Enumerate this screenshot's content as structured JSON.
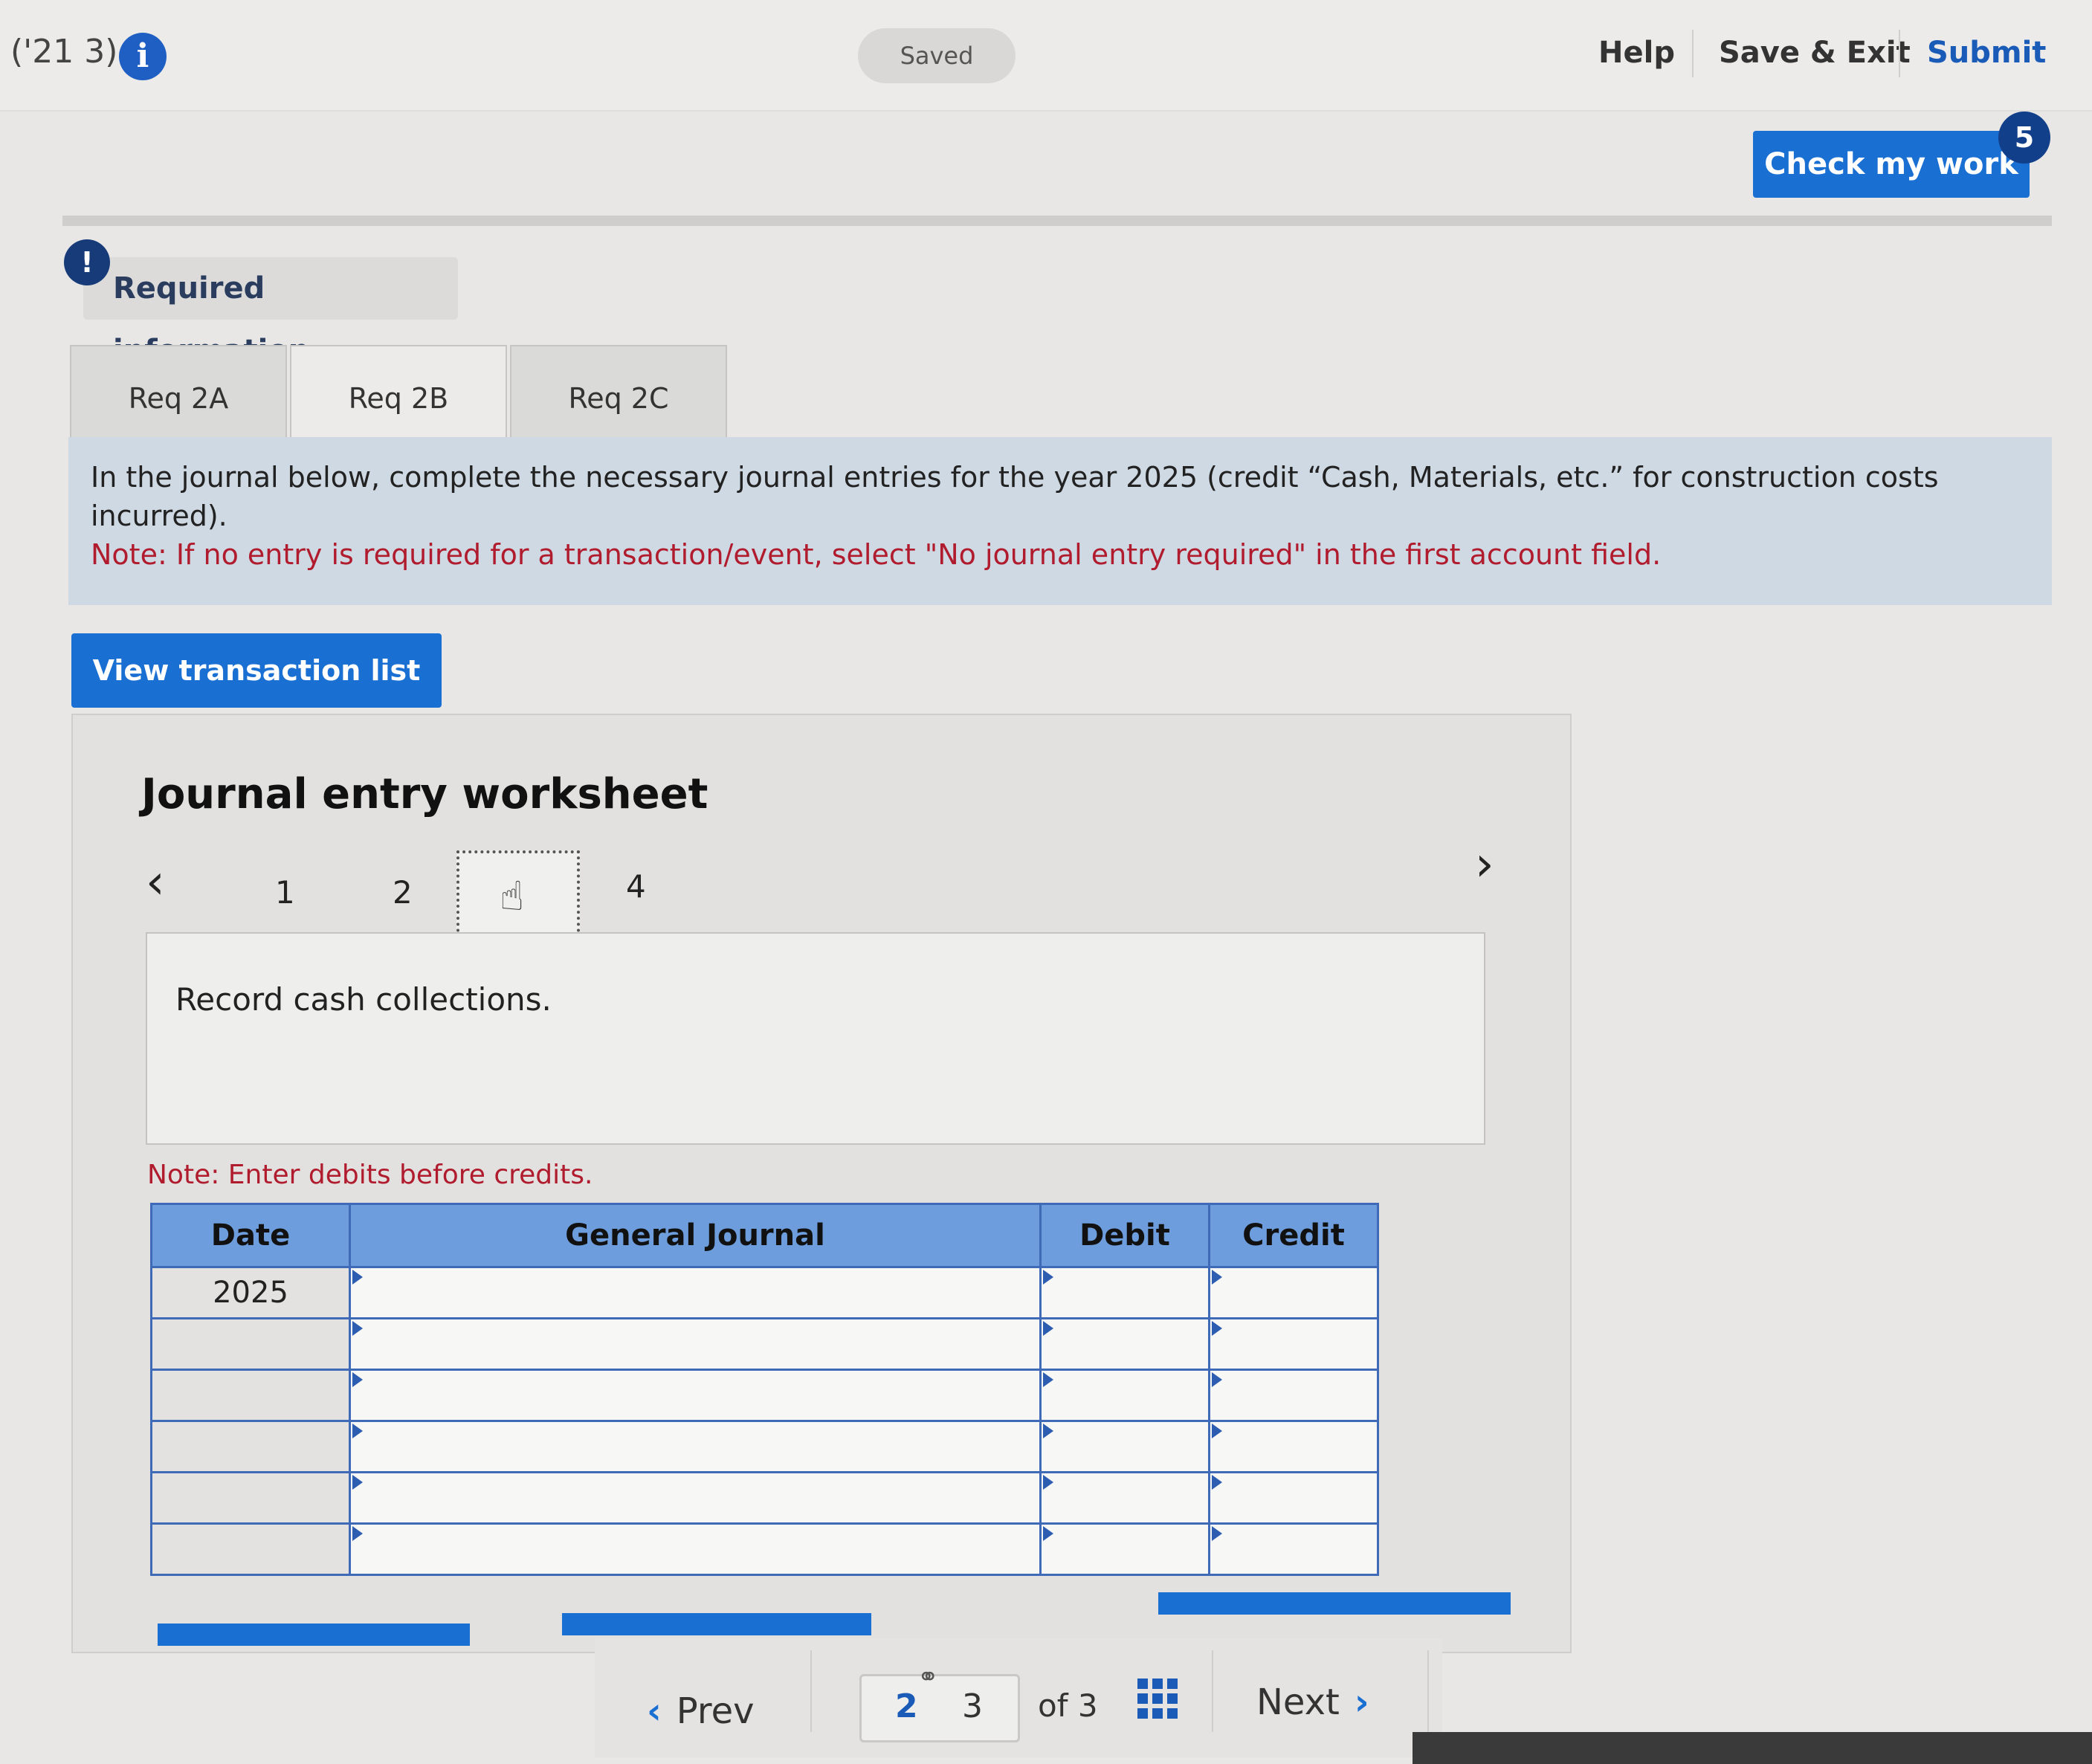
{
  "header": {
    "question_ref": "('21 3)",
    "status": "Saved",
    "links": [
      "Help",
      "Save & Exit",
      "Submit"
    ],
    "check_button": "Check my work",
    "check_badge": "5"
  },
  "required_info": {
    "icon": "!",
    "label": "Required information"
  },
  "tabs": [
    "Req 2A",
    "Req 2B",
    "Req 2C"
  ],
  "instruction": {
    "text": "In the journal below, complete the necessary journal entries for the year 2025 (credit “Cash, Materials, etc.” for construction costs incurred).",
    "note": "Note: If no entry is required for a transaction/event, select \"No journal entry required\" in the first account field."
  },
  "view_button": "View transaction list",
  "worksheet": {
    "title": "Journal entry worksheet",
    "pages": [
      "1",
      "2",
      "3",
      "4"
    ],
    "active_page": "3",
    "description": "Record cash collections.",
    "note": "Note: Enter debits before credits.",
    "columns": [
      "Date",
      "General Journal",
      "Debit",
      "Credit"
    ],
    "rows": [
      {
        "date": "2025",
        "account": "",
        "debit": "",
        "credit": ""
      },
      {
        "date": "",
        "account": "",
        "debit": "",
        "credit": ""
      },
      {
        "date": "",
        "account": "",
        "debit": "",
        "credit": ""
      },
      {
        "date": "",
        "account": "",
        "debit": "",
        "credit": ""
      },
      {
        "date": "",
        "account": "",
        "debit": "",
        "credit": ""
      },
      {
        "date": "",
        "account": "",
        "debit": "",
        "credit": ""
      }
    ]
  },
  "footer_nav": {
    "prev": "Prev",
    "current": "2",
    "next_page": "3",
    "of_total": "of 3",
    "next": "Next"
  },
  "colors": {
    "primary": "#1a6fd3",
    "table_header": "#6d9ddc",
    "note_red": "#b01c2e",
    "banner": "#cfd9e3"
  }
}
